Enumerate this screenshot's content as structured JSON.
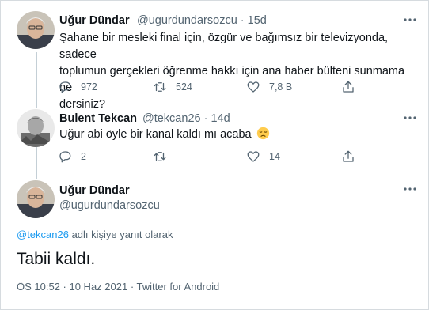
{
  "tweets": [
    {
      "author_name": "Uğur Dündar",
      "handle": "@ugurdundarsozcu",
      "time": "15d",
      "text_line1": "Şahane bir mesleki final için, özgür ve bağımsız bir televizyonda, sadece",
      "text_line2": "toplumun gerçekleri öğrenme hakkı için ana haber bülteni sunmama ne",
      "text_line3": "dersiniz?",
      "replies": "972",
      "retweets": "524",
      "likes": "7,8 B"
    },
    {
      "author_name": "Bulent Tekcan",
      "handle": "@tekcan26",
      "time": "14d",
      "text": "Uğur abi öyle bir kanal kaldı mı acaba",
      "emoji": "😞",
      "replies": "2",
      "retweets": "",
      "likes": "14"
    }
  ],
  "main_tweet": {
    "author_name": "Uğur Dündar",
    "handle": "@ugurdundarsozcu",
    "reply_to_handle": "@tekcan26",
    "reply_to_suffix": " adlı kişiye yanıt olarak",
    "text": "Tabii kaldı.",
    "timestamp": "ÖS 10:52 · 10 Haz 2021 · Twitter for Android"
  },
  "icons": [
    "more-icon",
    "reply-icon",
    "retweet-icon",
    "like-icon",
    "share-icon"
  ],
  "colors": {
    "accent": "#1d9bf0",
    "muted": "#536471",
    "text": "#0f1419",
    "line": "#c4cfd6"
  }
}
